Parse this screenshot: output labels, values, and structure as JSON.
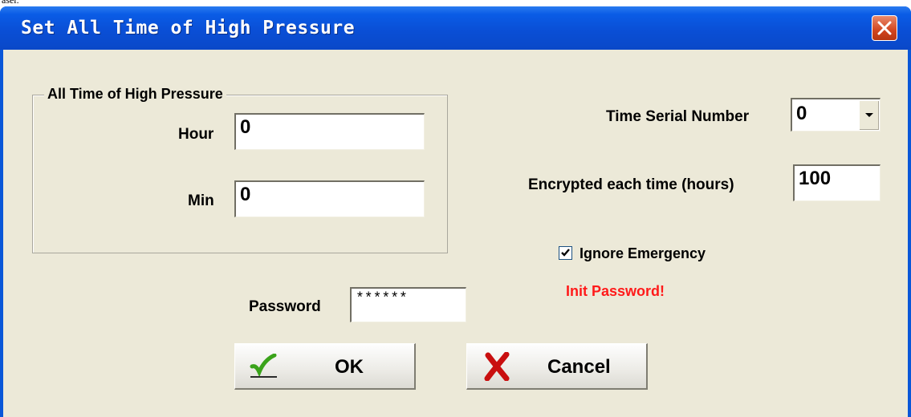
{
  "page_residue": "aser.",
  "window": {
    "title": "Set All Time of High Pressure"
  },
  "group": {
    "title": "All Time of High Pressure",
    "hour_label": "Hour",
    "hour_value": "0",
    "min_label": "Min",
    "min_value": "0"
  },
  "serial": {
    "label": "Time Serial Number",
    "value": "0"
  },
  "encrypted": {
    "label": "Encrypted each time (hours)",
    "value": "100"
  },
  "ignore_emergency": {
    "label": "Ignore Emergency",
    "checked": true
  },
  "warning": "Init Password!",
  "password": {
    "label": "Password",
    "value": "******"
  },
  "buttons": {
    "ok": "OK",
    "cancel": "Cancel"
  },
  "colors": {
    "titlebar": "#0a4fd6",
    "client": "#ece9d8",
    "warning": "#ff1a1a",
    "close": "#d2451f"
  }
}
